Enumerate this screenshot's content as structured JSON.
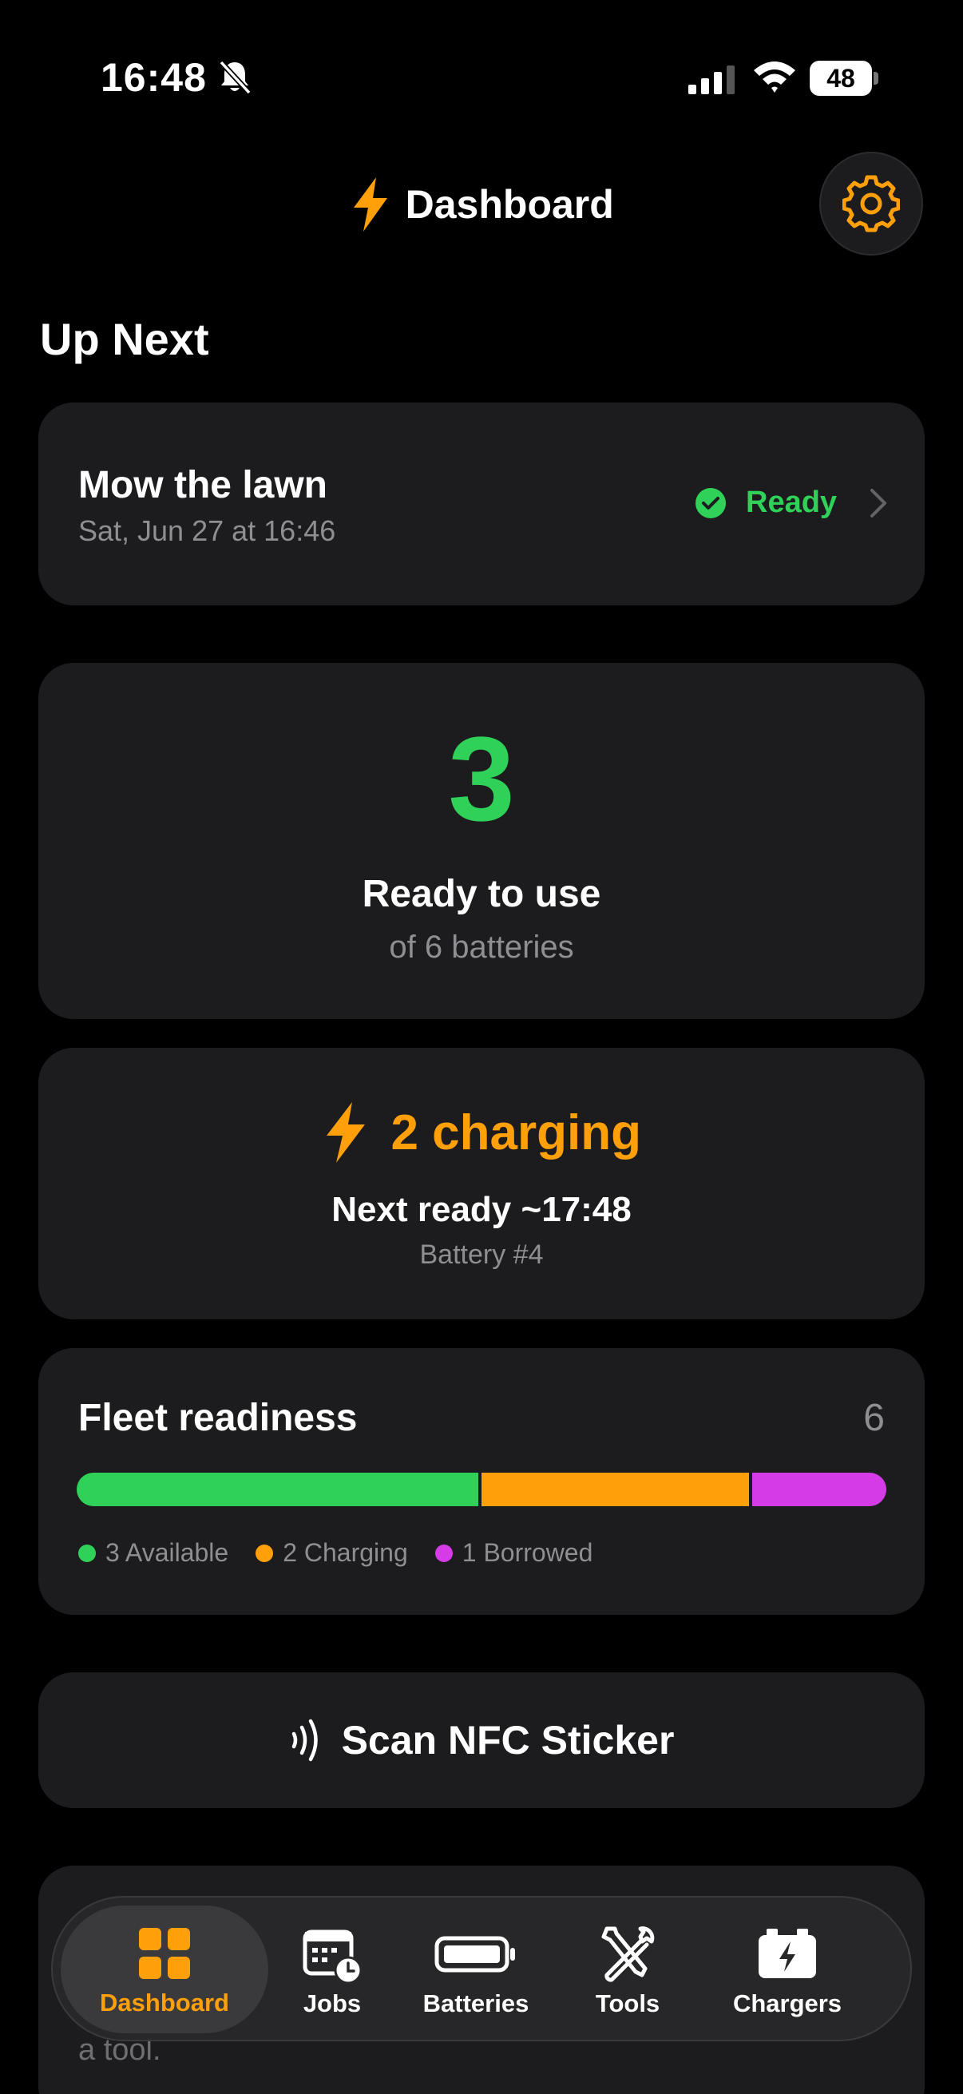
{
  "status_bar": {
    "time": "16:48",
    "battery_level": "48"
  },
  "header": {
    "title": "Dashboard"
  },
  "up_next": {
    "section_title": "Up Next",
    "job_name": "Mow the lawn",
    "job_date": "Sat, Jun 27 at 16:46",
    "status": "Ready"
  },
  "ready_card": {
    "count": "3",
    "label": "Ready to use",
    "subtitle": "of 6 batteries"
  },
  "charging_card": {
    "label": "2 charging",
    "next_ready": "Next ready ~17:48",
    "battery": "Battery #4"
  },
  "fleet": {
    "title": "Fleet readiness",
    "total": "6",
    "segments": [
      {
        "name": "Available",
        "count": 3,
        "color": "#30d158",
        "label": "3 Available"
      },
      {
        "name": "Charging",
        "count": 2,
        "color": "#ff9f0a",
        "label": "2 Charging"
      },
      {
        "name": "Borrowed",
        "count": 1,
        "color": "#d53ce8",
        "label": "1 Borrowed"
      }
    ]
  },
  "nfc": {
    "label": "Scan NFC Sticker"
  },
  "peek_card": {
    "text": "a tool."
  },
  "tabs": [
    {
      "label": "Dashboard",
      "icon": "grid-icon",
      "active": true
    },
    {
      "label": "Jobs",
      "icon": "calendar-clock-icon",
      "active": false
    },
    {
      "label": "Batteries",
      "icon": "battery-icon",
      "active": false
    },
    {
      "label": "Tools",
      "icon": "tools-icon",
      "active": false
    },
    {
      "label": "Chargers",
      "icon": "charger-icon",
      "active": false
    }
  ],
  "colors": {
    "accent": "#ff9f0a",
    "ready": "#30d158",
    "card": "#1c1c1e",
    "muted": "#8e8e93"
  }
}
